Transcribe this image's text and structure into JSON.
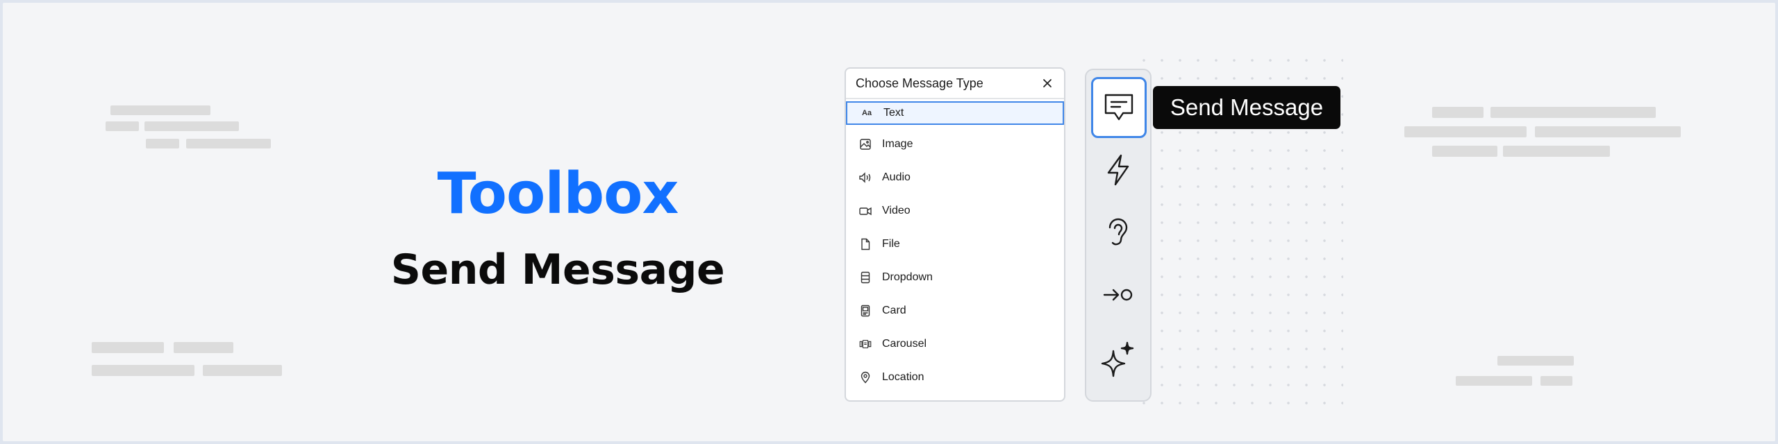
{
  "hero": {
    "title": "Toolbox",
    "subtitle": "Send Message"
  },
  "panel": {
    "title": "Choose Message Type",
    "close_icon": "close-icon",
    "items": [
      {
        "label": "Text",
        "icon": "text-aa-icon",
        "selected": true
      },
      {
        "label": "Image",
        "icon": "image-icon"
      },
      {
        "label": "Audio",
        "icon": "audio-icon"
      },
      {
        "label": "Video",
        "icon": "video-icon"
      },
      {
        "label": "File",
        "icon": "file-icon"
      },
      {
        "label": "Dropdown",
        "icon": "dropdown-icon"
      },
      {
        "label": "Card",
        "icon": "card-icon"
      },
      {
        "label": "Carousel",
        "icon": "carousel-icon"
      },
      {
        "label": "Location",
        "icon": "location-pin-icon"
      }
    ],
    "text_icon_glyph": "Aa"
  },
  "toolbar": {
    "tools": [
      {
        "name": "message-icon",
        "active": true
      },
      {
        "name": "lightning-icon"
      },
      {
        "name": "ear-icon"
      },
      {
        "name": "arrow-to-circle-icon"
      },
      {
        "name": "sparkles-icon"
      }
    ]
  },
  "tooltip": {
    "label": "Send Message"
  },
  "colors": {
    "accent": "#1170ff",
    "selection": "#3f86e8",
    "tooltip_bg": "#0a0a0a",
    "background": "#f4f5f7"
  }
}
